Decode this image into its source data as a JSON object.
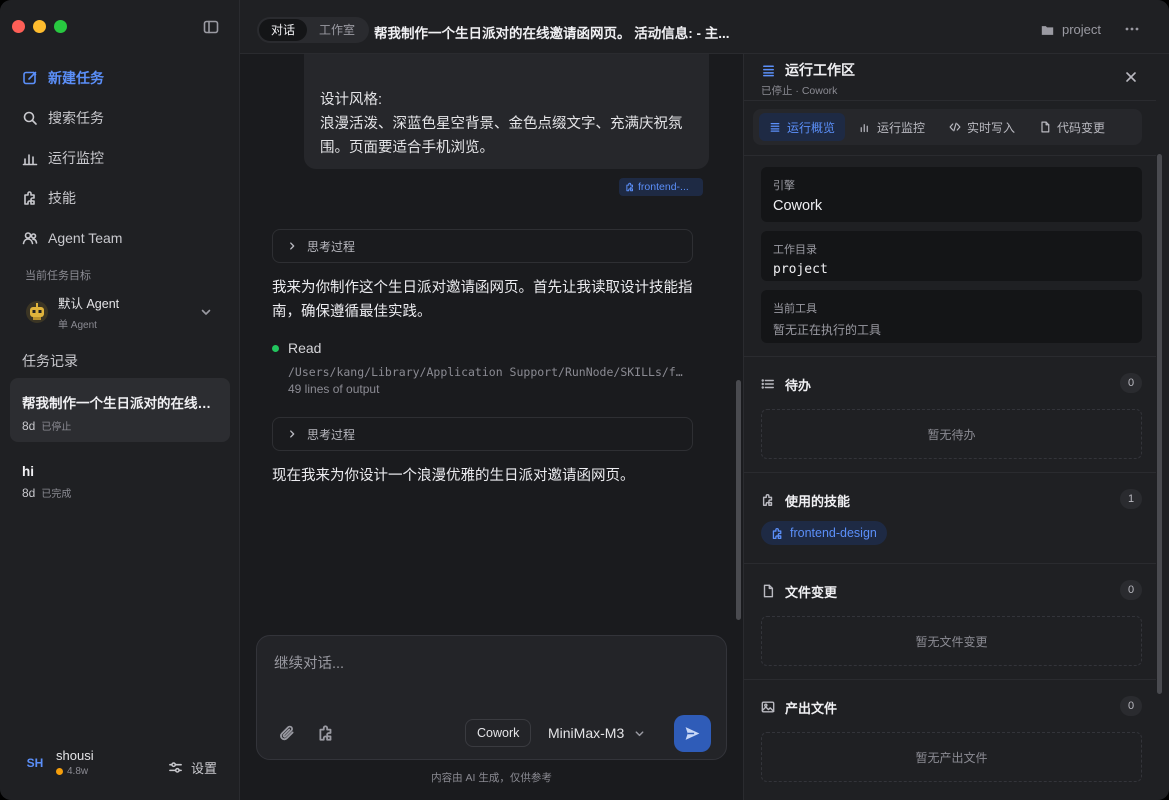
{
  "sidebar": {
    "nav": [
      {
        "label": "新建任务",
        "icon": "edit-icon",
        "active": true
      },
      {
        "label": "搜索任务",
        "icon": "search-icon"
      },
      {
        "label": "运行监控",
        "icon": "bar-chart-icon"
      },
      {
        "label": "技能",
        "icon": "puzzle-icon"
      },
      {
        "label": "Agent Team",
        "icon": "team-icon"
      }
    ],
    "goal_label": "当前任务目标",
    "agent": {
      "name": "默认 Agent",
      "sub": "单 Agent"
    },
    "history_title": "任务记录",
    "history": [
      {
        "title": "帮我制作一个生日派对的在线邀请函网页。",
        "age": "8d",
        "status": "已停止"
      },
      {
        "title": "hi",
        "age": "8d",
        "status": "已完成"
      }
    ],
    "user": {
      "initials": "SH",
      "name": "shousi",
      "points": "4.8w"
    },
    "settings_label": "设置"
  },
  "topbar": {
    "tabs": [
      "对话",
      "工作室"
    ],
    "title": "帮我制作一个生日派对的在线邀请函网页。 活动信息: - 主...",
    "project": "project"
  },
  "chat": {
    "user_bubble": {
      "heading": "设计风格:",
      "body": "浪漫活泼、深蓝色星空背景、金色点缀文字、充满庆祝氛围。页面要适合手机浏览。"
    },
    "skill_tag": "frontend-...",
    "thinking_label": "思考过程",
    "msg1": "我来为你制作这个生日派对邀请函网页。首先让我读取设计技能指南，确保遵循最佳实践。",
    "tool": {
      "name": "Read",
      "path": "/Users/kang/Library/Application Support/RunNode/SKILLs/frontend-design/SKILL.md",
      "output": "49 lines of output"
    },
    "msg2": "现在我来为你设计一个浪漫优雅的生日派对邀请函网页。"
  },
  "composer": {
    "placeholder": "继续对话...",
    "mode": "Cowork",
    "model": "MiniMax-M3",
    "disclaimer": "内容由 AI 生成，仅供参考"
  },
  "panel": {
    "title": "运行工作区",
    "subtitle": "已停止 · Cowork",
    "tabs": [
      "运行概览",
      "运行监控",
      "实时写入",
      "代码变更"
    ],
    "engine": {
      "label": "引擎",
      "value": "Cowork"
    },
    "workdir": {
      "label": "工作目录",
      "value": "project"
    },
    "current_tool": {
      "label": "当前工具",
      "value": "暂无正在执行的工具"
    },
    "todo": {
      "title": "待办",
      "count": "0",
      "empty": "暂无待办"
    },
    "skills": {
      "title": "使用的技能",
      "count": "1",
      "items": [
        "frontend-design"
      ]
    },
    "files": {
      "title": "文件变更",
      "count": "0",
      "empty": "暂无文件变更"
    },
    "outputs": {
      "title": "产出文件",
      "count": "0",
      "empty": "暂无产出文件"
    }
  },
  "colors": {
    "accent": "#5b8ff9",
    "send": "#2f5cb8",
    "running_dot": "#22c55e"
  }
}
